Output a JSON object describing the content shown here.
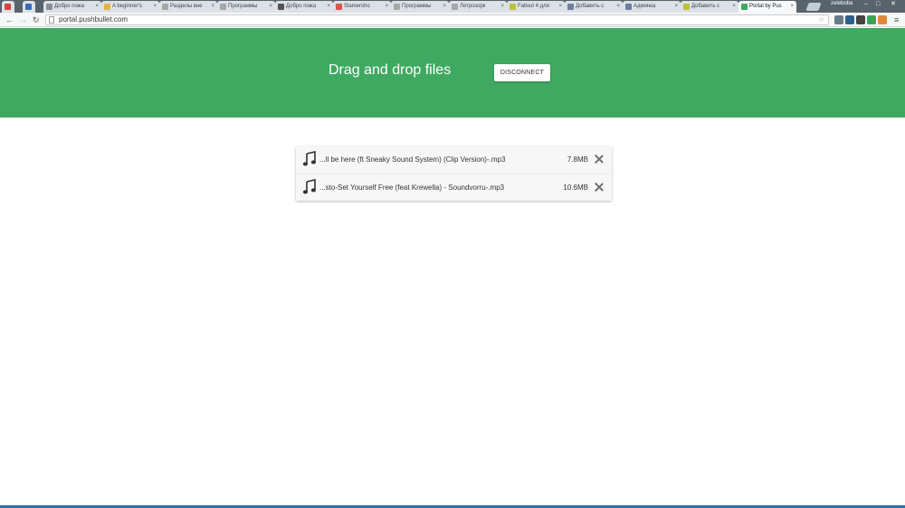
{
  "browser": {
    "tabs": [
      {
        "label": "",
        "favicon_color": "#d44638",
        "icon": "gmail-icon"
      },
      {
        "label": "",
        "favicon_color": "#3b6db5",
        "icon": "site-icon"
      },
      {
        "label": "Добро пожа",
        "favicon_color": "#8a8f93"
      },
      {
        "label": "A beginner's",
        "favicon_color": "#e0b548"
      },
      {
        "label": "Разделы вне",
        "favicon_color": "#a7a7a7"
      },
      {
        "label": "Программы",
        "favicon_color": "#a7a7a7"
      },
      {
        "label": "Добро пожа",
        "favicon_color": "#555555"
      },
      {
        "label": "Slamersho",
        "favicon_color": "#d9534f"
      },
      {
        "label": "Программы",
        "favicon_color": "#a7a7a7"
      },
      {
        "label": "Летрозорк",
        "favicon_color": "#a7a7a7"
      },
      {
        "label": "Fallout 4 для",
        "favicon_color": "#bcbf3b"
      },
      {
        "label": "Добавить с",
        "favicon_color": "#6c7fa0"
      },
      {
        "label": "Админка",
        "favicon_color": "#6c7fa0"
      },
      {
        "label": "Добавить с",
        "favicon_color": "#bcbf3b"
      },
      {
        "label": "Portal by Pus",
        "favicon_color": "#3fa961",
        "active": true
      }
    ],
    "user_name": "zeleboba",
    "address": "portal.pushbullet.com",
    "extension_colors": [
      "#6a7a8a",
      "#2e5f8a",
      "#444444",
      "#3aa35b",
      "#e08a3a"
    ]
  },
  "hero": {
    "title": "Drag and drop files",
    "disconnect_label": "DISCONNECT",
    "background": "#3fa961"
  },
  "files": [
    {
      "name": "...ll be here (ft Sneaky Sound System) (Clip Version)-.mp3",
      "size": "7.8MB",
      "icon": "music-note-icon"
    },
    {
      "name": "...sto-Set Yourself Free (feat Krewella) - Soundvorru-.mp3",
      "size": "10.6MB",
      "icon": "music-note-icon"
    }
  ]
}
